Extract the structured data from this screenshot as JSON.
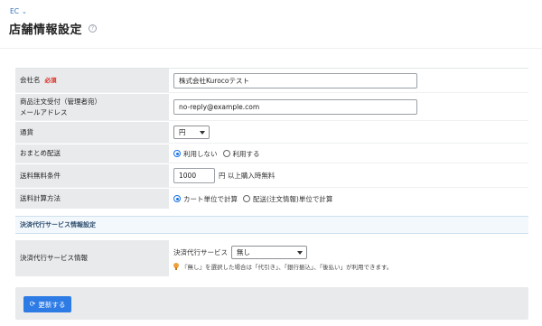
{
  "breadcrumb": {
    "label": "EC"
  },
  "page": {
    "title": "店舗情報設定"
  },
  "form": {
    "company": {
      "label": "会社名",
      "required": "必須",
      "value": "株式会社Kurocoテスト"
    },
    "order_email": {
      "label_line1": "商品注文受付（管理者宛）",
      "label_line2": "メールアドレス",
      "value": "no-reply@example.com"
    },
    "currency": {
      "label": "通貨",
      "selected": "円"
    },
    "bundle_shipping": {
      "label": "おまとめ配送",
      "options": [
        "利用しない",
        "利用する"
      ],
      "selected_index": 0
    },
    "free_shipping": {
      "label": "送料無料条件",
      "value": "1000",
      "suffix": "円 以上購入時無料"
    },
    "shipping_calc": {
      "label": "送料計算方法",
      "options": [
        "カート単位で計算",
        "配送(注文情報)単位で計算"
      ],
      "selected_index": 0
    }
  },
  "payment_section": {
    "heading": "決済代行サービス情報設定",
    "label": "決済代行サービス情報",
    "field_label": "決済代行サービス",
    "selected": "無し",
    "note": "『無し』を選択した場合は「代引き」、「銀行振込」、「後払い」が利用できます。"
  },
  "footer": {
    "update_label": "更新する"
  },
  "colors": {
    "accent": "#2d7be5",
    "required": "#d9281e",
    "header_bg": "#e9eaec"
  }
}
